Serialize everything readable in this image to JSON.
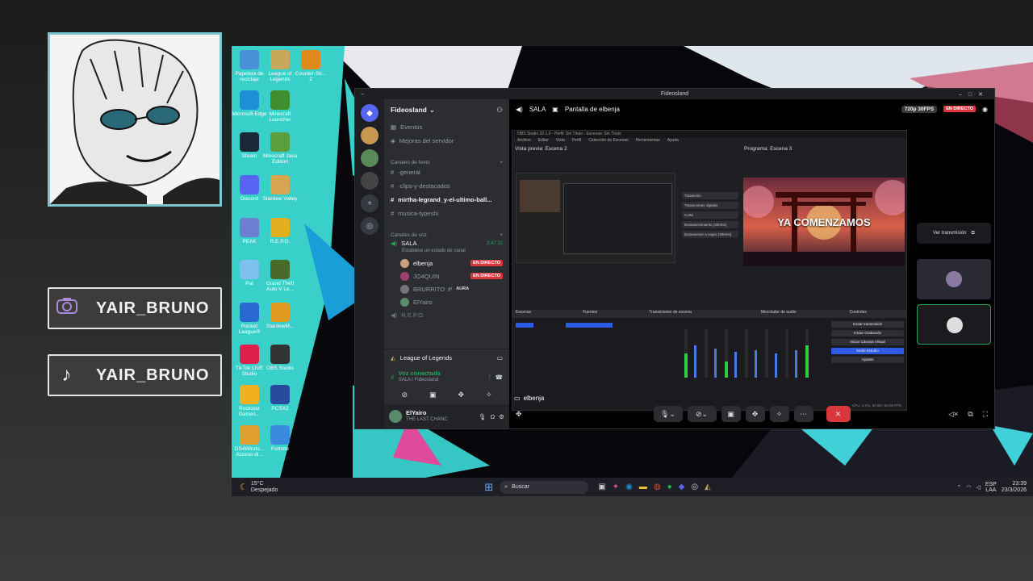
{
  "overlay": {
    "handles": [
      {
        "icon": "camera-icon",
        "label": "YAIR_BRUNO"
      },
      {
        "icon": "tiktok-icon",
        "label": "YAIR_BRUNO"
      }
    ]
  },
  "desktop": {
    "icons": [
      {
        "label": "Papelera de reciclaje",
        "color": "#4a90d9"
      },
      {
        "label": "League of Legends",
        "color": "#c8a85a"
      },
      {
        "label": "Counter-Str... 2",
        "color": "#e08a1e"
      },
      {
        "label": "Microsoft Edge",
        "color": "#1e8fd6"
      },
      {
        "label": "Minecraft Launcher",
        "color": "#3f8f2f"
      },
      {
        "label": "Steam",
        "color": "#1b2838"
      },
      {
        "label": "Minecraft Java Edition",
        "color": "#5c9e3c"
      },
      {
        "label": "Discord",
        "color": "#5865f2"
      },
      {
        "label": "Stardew Valley",
        "color": "#d7a550"
      },
      {
        "label": "PEAK",
        "color": "#6a7fd0"
      },
      {
        "label": "R.E.P.O.",
        "color": "#e0b020"
      },
      {
        "label": "Pal",
        "color": "#7fc0f0"
      },
      {
        "label": "Grand Theft Auto V Le...",
        "color": "#4a6a2a"
      },
      {
        "label": "Rocket League®",
        "color": "#2a6ad0"
      },
      {
        "label": "StardewM...",
        "color": "#e09a20"
      },
      {
        "label": "TikTok LIVE Studio",
        "color": "#e0204a"
      },
      {
        "label": "OBS Studio",
        "color": "#333"
      },
      {
        "label": "Rockstar Games...",
        "color": "#f0b020"
      },
      {
        "label": "PCSX2",
        "color": "#2a4aa0"
      },
      {
        "label": "DS4Windo... Acceso di...",
        "color": "#e0a030"
      },
      {
        "label": "Fortnite",
        "color": "#3a8ae0"
      }
    ]
  },
  "taskbar": {
    "weather_temp": "15°C",
    "weather_desc": "Despejado",
    "search_placeholder": "Buscar",
    "lang": "ESP",
    "lang_sub": "LAA",
    "time": "23:39",
    "date": "23/3/2026"
  },
  "discord": {
    "window_title": "Fideosland",
    "server_name": "Fideosland",
    "nav": [
      {
        "icon": "calendar-icon",
        "label": "Eventos"
      },
      {
        "icon": "rocket-icon",
        "label": "Mejoras del servidor"
      }
    ],
    "text_category": "Canales de texto",
    "text_channels": [
      "-general",
      "-clips-y-destacados",
      "mirtha-legrand_y-el-ultimo-ball...",
      "musica-typeshi"
    ],
    "voice_category": "Canales de voz",
    "voice_channel": {
      "name": "SALA",
      "timer": "3:47:32",
      "status": "Establece un estado de canal"
    },
    "voice_users": [
      {
        "name": "elbenja",
        "badge": "EN DIRECTO",
        "color": "#c9a080"
      },
      {
        "name": "JO4QUIN",
        "badge": "EN DIRECTO",
        "color": "#a04070"
      },
      {
        "name": "BRURRITO :P",
        "badge": "AURA",
        "color": "#777"
      },
      {
        "name": "ElYairo",
        "badge": "",
        "color": "#5a8a6a"
      }
    ],
    "next_voice": "R.E.P.O.",
    "activity": "League of Legends",
    "connection": {
      "label": "Voz conectada",
      "sub": "SALA / Fideosland"
    },
    "user": {
      "name": "ElYairo",
      "status": "THE LAST CHANC"
    },
    "stream_header": {
      "channel": "SALA",
      "title": "Pantalla de elbenja",
      "quality": "720p 30FPS",
      "live": "EN DIRECTO"
    },
    "stream_label": "elbenja",
    "side_panel": {
      "view_stream": "Ver transmisión"
    }
  },
  "obs": {
    "title": "OBS Studio 32.1.0 - Perfil: Sin Título - Escenas: Sin Título",
    "menu": [
      "Archivo",
      "Editar",
      "Vista",
      "Perfil",
      "Colección de Escenas",
      "Herramientas",
      "Ayuda"
    ],
    "preview_label": "Vista previa: Escena 2",
    "program_label": "Programa: Escena 3",
    "program_text": "YA COMENZAMOS",
    "transition_buttons": [
      "Transición",
      "Transiciones rápidas",
      "Corte",
      "Desvanecimiento (300ms)",
      "Desvanecer a negro (300ms)"
    ],
    "docks": [
      "Escenas",
      "Fuentes",
      "Transiciones de escena",
      "Mezclador de audio",
      "Controles"
    ],
    "controls": [
      "Iniciar transmisión",
      "Iniciar Grabación",
      "Iniciar Cámara Virtual",
      "Modo Estudio",
      "Ajustes"
    ],
    "status_fps": "CPU: 1.4%, 60.00 / 60.00 FPS"
  },
  "colors": {
    "discord_bg": "#2b2d31",
    "live_red": "#da373c",
    "obs_blue": "#2d5ae6",
    "accent_teal": "#4fd6cf"
  }
}
